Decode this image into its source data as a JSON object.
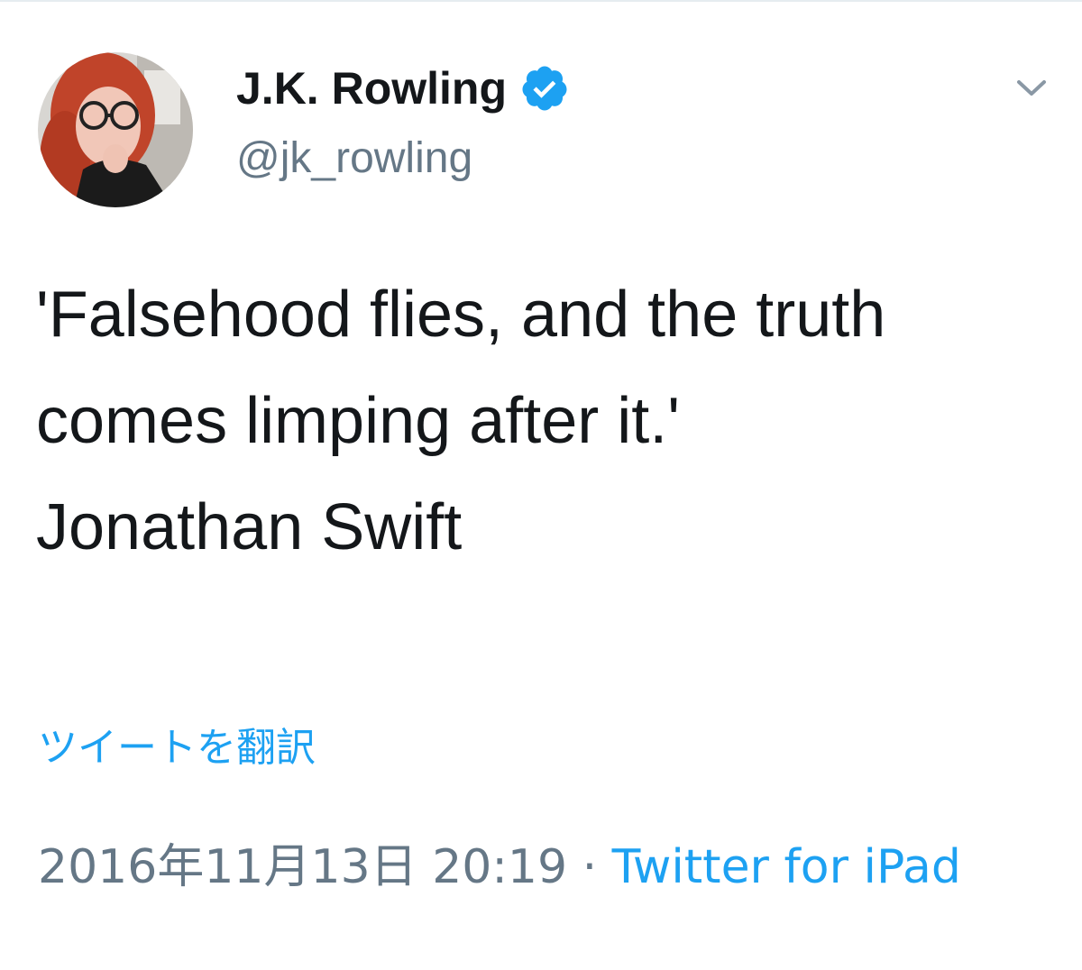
{
  "author": {
    "display_name": "J.K. Rowling",
    "handle": "@jk_rowling",
    "verified_icon": "verified-badge-icon"
  },
  "menu_icon": "chevron-down-icon",
  "tweet": {
    "line1": "'Falsehood flies, and the truth comes limping after it.'",
    "line2": "Jonathan Swift"
  },
  "translate_label": "ツイートを翻訳",
  "meta": {
    "timestamp": "2016年11月13日 20:19",
    "separator": " · ",
    "source": "Twitter for iPad"
  },
  "colors": {
    "link": "#1da1f2",
    "secondary_text": "#657786",
    "primary_text": "#14171a"
  }
}
